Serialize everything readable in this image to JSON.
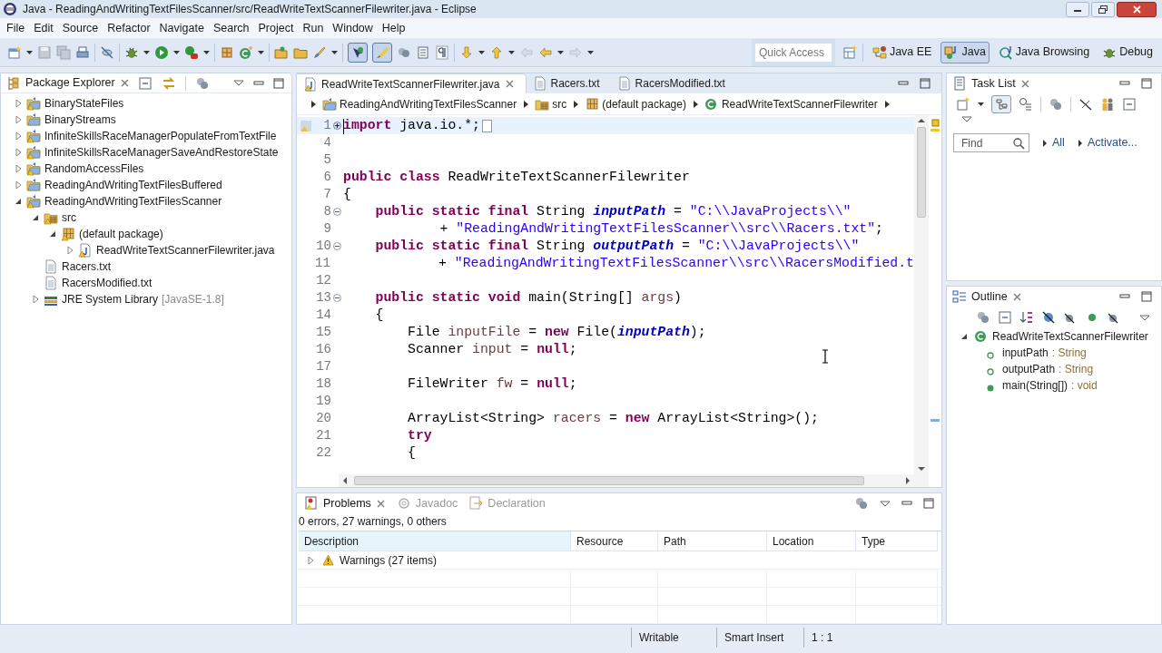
{
  "window": {
    "title": "Java - ReadingAndWritingTextFilesScanner/src/ReadWriteTextScannerFilewriter.java - Eclipse"
  },
  "menu": [
    "File",
    "Edit",
    "Source",
    "Refactor",
    "Navigate",
    "Search",
    "Project",
    "Run",
    "Window",
    "Help"
  ],
  "quick_access": {
    "placeholder": "Quick Access"
  },
  "perspectives": [
    {
      "label": "Java EE",
      "selected": false
    },
    {
      "label": "Java",
      "selected": true
    },
    {
      "label": "Java Browsing",
      "selected": false
    },
    {
      "label": "Debug",
      "selected": false
    }
  ],
  "package_explorer": {
    "title": "Package Explorer",
    "tree": [
      {
        "label": "BinaryStateFiles",
        "kind": "project",
        "warning": true,
        "expanded": false
      },
      {
        "label": "BinaryStreams",
        "kind": "project",
        "warning": false,
        "expanded": false
      },
      {
        "label": "InfiniteSkillsRaceManagerPopulateFromTextFile",
        "kind": "project",
        "warning": true,
        "expanded": false
      },
      {
        "label": "InfiniteSkillsRaceManagerSaveAndRestoreState",
        "kind": "project",
        "warning": true,
        "expanded": false
      },
      {
        "label": "RandomAccessFiles",
        "kind": "project",
        "warning": true,
        "expanded": false
      },
      {
        "label": "ReadingAndWritingTextFilesBuffered",
        "kind": "project",
        "warning": false,
        "expanded": false
      },
      {
        "label": "ReadingAndWritingTextFilesScanner",
        "kind": "project",
        "warning": true,
        "expanded": true,
        "children": [
          {
            "label": "src",
            "kind": "source",
            "warning": true,
            "expanded": true,
            "children": [
              {
                "label": "(default package)",
                "kind": "package",
                "warning": true,
                "expanded": true,
                "children": [
                  {
                    "label": "ReadWriteTextScannerFilewriter.java",
                    "kind": "java",
                    "warning": true,
                    "expanded": false
                  }
                ]
              }
            ]
          },
          {
            "label": "Racers.txt",
            "kind": "text",
            "warning": false
          },
          {
            "label": "RacersModified.txt",
            "kind": "text",
            "warning": false
          },
          {
            "label": "JRE System Library",
            "suffix": "[JavaSE-1.8]",
            "kind": "library",
            "warning": false,
            "expanded": false
          }
        ]
      }
    ]
  },
  "editor": {
    "tabs": [
      {
        "label": "ReadWriteTextScannerFilewriter.java",
        "kind": "java",
        "selected": true
      },
      {
        "label": "Racers.txt",
        "kind": "text",
        "selected": false
      },
      {
        "label": "RacersModified.txt",
        "kind": "text",
        "selected": false
      }
    ],
    "breadcrumb": [
      {
        "label": "ReadingAndWritingTextFilesScanner",
        "kind": "project"
      },
      {
        "label": "src",
        "kind": "source"
      },
      {
        "label": "(default package)",
        "kind": "package"
      },
      {
        "label": "ReadWriteTextScannerFilewriter",
        "kind": "class"
      }
    ],
    "lines": [
      {
        "number": "1",
        "folded": true,
        "tokens": [
          {
            "kind": "keyword",
            "text": "import"
          },
          {
            "kind": "plain",
            "text": " java.io.*;"
          }
        ]
      },
      {
        "number": "4"
      },
      {
        "number": "5"
      },
      {
        "number": "6",
        "tokens": [
          {
            "kind": "keyword",
            "text": "public class"
          },
          {
            "kind": "plain",
            "text": " ReadWriteTextScannerFilewriter"
          }
        ]
      },
      {
        "number": "7",
        "tokens": [
          {
            "kind": "plain",
            "text": "{"
          }
        ]
      },
      {
        "number": "8",
        "folded": false,
        "tokens": [
          {
            "kind": "keyword",
            "text": "    public static final"
          },
          {
            "kind": "plain",
            "text": " String "
          },
          {
            "kind": "field",
            "text": "inputPath"
          },
          {
            "kind": "plain",
            "text": " = "
          },
          {
            "kind": "string",
            "text": "\"C:\\\\JavaProjects\\\\\""
          }
        ]
      },
      {
        "number": "9",
        "tokens": [
          {
            "kind": "plain",
            "text": "            + "
          },
          {
            "kind": "string",
            "text": "\"ReadingAndWritingTextFilesScanner\\\\src\\\\Racers.txt\""
          },
          {
            "kind": "plain",
            "text": ";"
          }
        ]
      },
      {
        "number": "10",
        "folded": false,
        "tokens": [
          {
            "kind": "keyword",
            "text": "    public static final"
          },
          {
            "kind": "plain",
            "text": " String "
          },
          {
            "kind": "field",
            "text": "outputPath"
          },
          {
            "kind": "plain",
            "text": " = "
          },
          {
            "kind": "string",
            "text": "\"C:\\\\JavaProjects\\\\\""
          }
        ]
      },
      {
        "number": "11",
        "tokens": [
          {
            "kind": "plain",
            "text": "            + "
          },
          {
            "kind": "string",
            "text": "\"ReadingAndWritingTextFilesScanner\\\\src\\\\RacersModified.t"
          }
        ]
      },
      {
        "number": "12"
      },
      {
        "number": "13",
        "folded": false,
        "tokens": [
          {
            "kind": "keyword",
            "text": "    public static void"
          },
          {
            "kind": "plain",
            "text": " main(String[] "
          },
          {
            "kind": "local",
            "text": "args"
          },
          {
            "kind": "plain",
            "text": ")"
          }
        ]
      },
      {
        "number": "14",
        "tokens": [
          {
            "kind": "plain",
            "text": "    {"
          }
        ]
      },
      {
        "number": "15",
        "tokens": [
          {
            "kind": "plain",
            "text": "        File "
          },
          {
            "kind": "local",
            "text": "inputFile"
          },
          {
            "kind": "plain",
            "text": " = "
          },
          {
            "kind": "keyword",
            "text": "new"
          },
          {
            "kind": "plain",
            "text": " File("
          },
          {
            "kind": "field",
            "text": "inputPath"
          },
          {
            "kind": "plain",
            "text": ");"
          }
        ]
      },
      {
        "number": "16",
        "tokens": [
          {
            "kind": "plain",
            "text": "        Scanner "
          },
          {
            "kind": "local",
            "text": "input"
          },
          {
            "kind": "plain",
            "text": " = "
          },
          {
            "kind": "keyword",
            "text": "null"
          },
          {
            "kind": "plain",
            "text": ";"
          }
        ]
      },
      {
        "number": "17"
      },
      {
        "number": "18",
        "tokens": [
          {
            "kind": "plain",
            "text": "        FileWriter "
          },
          {
            "kind": "local",
            "text": "fw"
          },
          {
            "kind": "plain",
            "text": " = "
          },
          {
            "kind": "keyword",
            "text": "null"
          },
          {
            "kind": "plain",
            "text": ";"
          }
        ]
      },
      {
        "number": "19"
      },
      {
        "number": "20",
        "tokens": [
          {
            "kind": "plain",
            "text": "        ArrayList<String> "
          },
          {
            "kind": "local",
            "text": "racers"
          },
          {
            "kind": "plain",
            "text": " = "
          },
          {
            "kind": "keyword",
            "text": "new"
          },
          {
            "kind": "plain",
            "text": " ArrayList<String>();"
          }
        ]
      },
      {
        "number": "21",
        "tokens": [
          {
            "kind": "keyword",
            "text": "        try"
          }
        ]
      },
      {
        "number": "22",
        "tokens": [
          {
            "kind": "plain",
            "text": "        {"
          }
        ]
      }
    ]
  },
  "task_list": {
    "title": "Task List",
    "find": {
      "placeholder": "Find"
    },
    "links": [
      "All",
      "Activate..."
    ]
  },
  "outline": {
    "title": "Outline",
    "tree": [
      {
        "label": "ReadWriteTextScannerFilewriter",
        "kind": "class",
        "expanded": true,
        "children": [
          {
            "label": "inputPath",
            "type": ": String",
            "kind": "field"
          },
          {
            "label": "outputPath",
            "type": ": String",
            "kind": "field"
          },
          {
            "label": "main(String[])",
            "type": ": void",
            "kind": "method"
          }
        ]
      }
    ]
  },
  "problems": {
    "tabs": [
      {
        "label": "Problems",
        "selected": true
      },
      {
        "label": "Javadoc",
        "selected": false
      },
      {
        "label": "Declaration",
        "selected": false
      }
    ],
    "summary": "0 errors, 27 warnings, 0 others",
    "columns": [
      "Description",
      "Resource",
      "Path",
      "Location",
      "Type"
    ],
    "rows": [
      {
        "description": "Warnings (27 items)",
        "expanded": false
      }
    ]
  },
  "status_bar": [
    "Writable",
    "Smart Insert",
    "1 : 1"
  ]
}
